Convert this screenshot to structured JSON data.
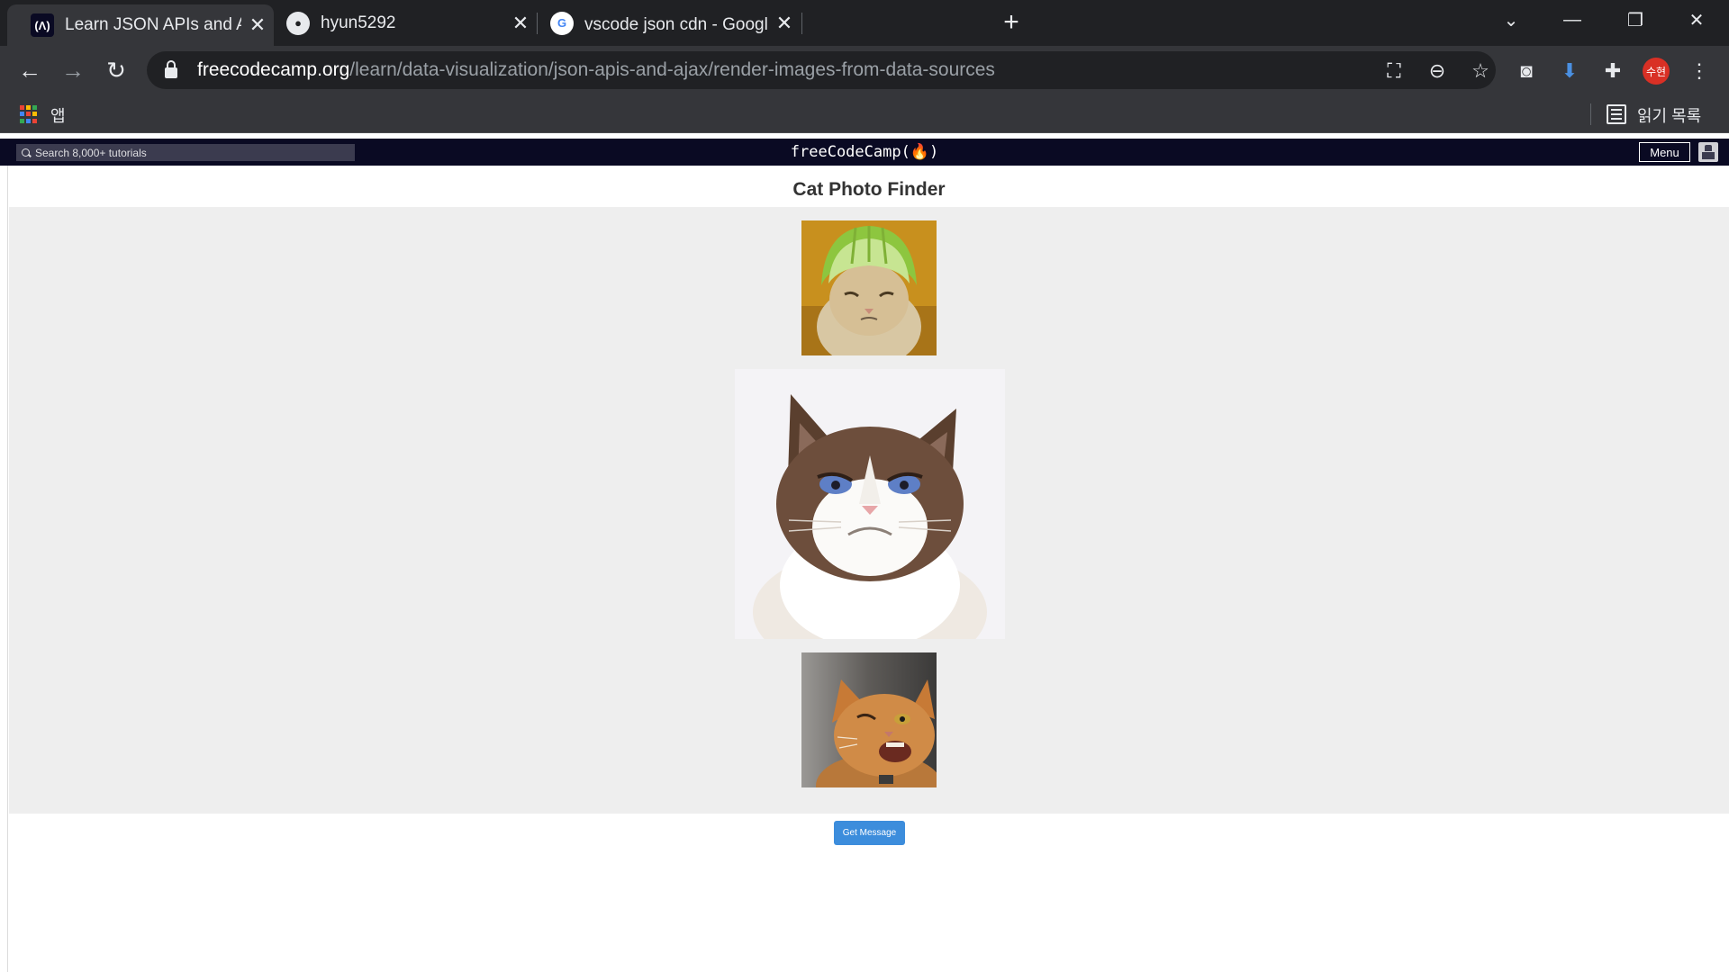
{
  "browser": {
    "tabs": [
      {
        "title": "Learn JSON APIs and Ajax: Rend",
        "favicon": "freecodecamp-icon",
        "active": true
      },
      {
        "title": "hyun5292",
        "favicon": "github-icon",
        "active": false
      },
      {
        "title": "vscode json cdn - Google 검색",
        "favicon": "google-icon",
        "active": false
      }
    ],
    "url_host": "freecodecamp.org",
    "url_path": "/learn/data-visualization/json-apis-and-ajax/render-images-from-data-sources",
    "profile_initials": "수현",
    "bookmarks": {
      "apps_label": "앱",
      "reading_list_label": "읽기 목록"
    }
  },
  "fcc_nav": {
    "search_placeholder": "Search 8,000+ tutorials",
    "logo_text": "freeCodeCamp(🔥)",
    "menu_label": "Menu"
  },
  "preview": {
    "title": "Cat Photo Finder",
    "cats": [
      {
        "name": "cat-lime-helmet-image",
        "alt": "A white cat wearing a green, helmet shaped melon on it's head."
      },
      {
        "name": "grumpy-cat-image",
        "alt": "A white cat with blue eyes, looking very grumpy."
      },
      {
        "name": "orange-cat-image",
        "alt": "An orange cat winking with one eye open."
      }
    ],
    "button_label": "Get Message"
  },
  "colors": {
    "chrome_dark": "#202124",
    "chrome_toolbar": "#35363a",
    "fcc_nav": "#0a0a23",
    "message_bg": "#eeeeee",
    "button": "#3c8ddc"
  }
}
